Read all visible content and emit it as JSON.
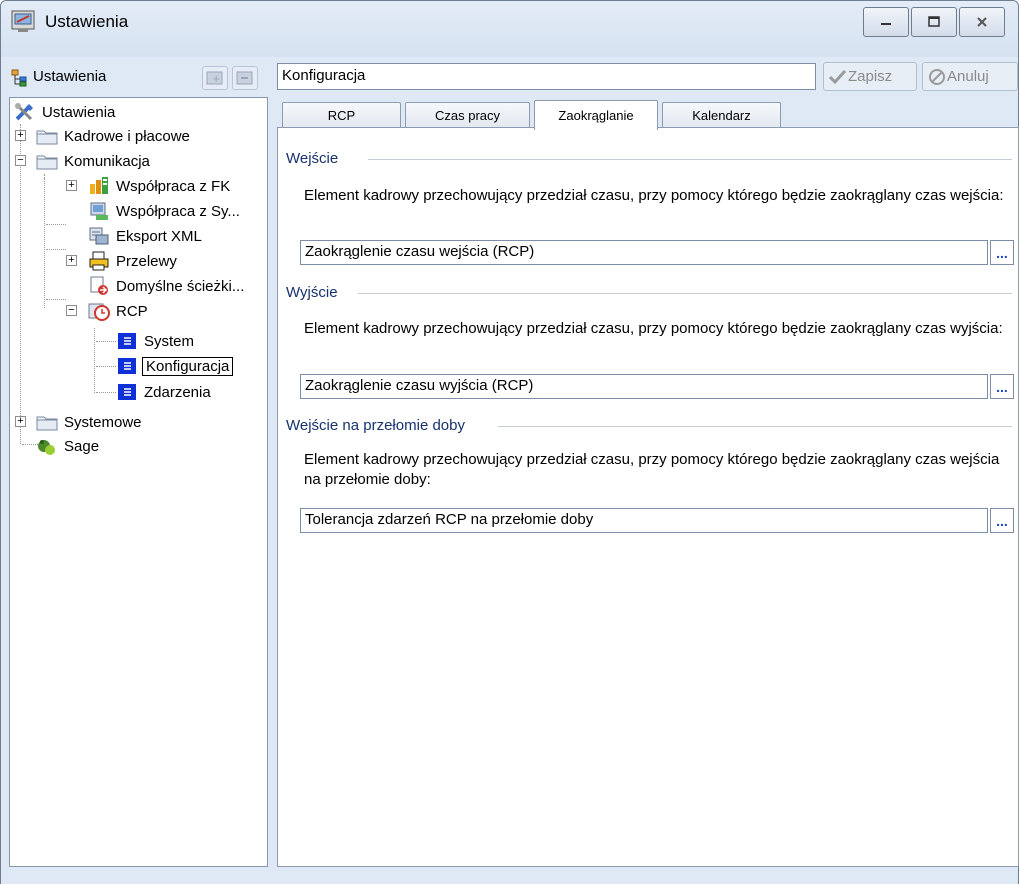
{
  "window": {
    "title": "Ustawienia",
    "icon": "settings-window-icon"
  },
  "left_panel": {
    "title": "Ustawienia",
    "tree": {
      "root": "Ustawienia",
      "kadrowe": "Kadrowe i płacowe",
      "komunikacja": "Komunikacja",
      "wspolpraca_fk": "Współpraca z FK",
      "wspolpraca_sy": "Współpraca z Sy...",
      "eksport_xml": "Eksport XML",
      "przelewy": "Przelewy",
      "domyslne": "Domyślne ścieżki...",
      "rcp": "RCP",
      "system": "System",
      "konfiguracja": "Konfiguracja",
      "zdarzenia": "Zdarzenia",
      "systemowe": "Systemowe",
      "sage": "Sage"
    }
  },
  "header": {
    "config_value": "Konfiguracja",
    "save_label": "Zapisz",
    "cancel_label": "Anuluj"
  },
  "tabs": [
    {
      "label": "RCP"
    },
    {
      "label": "Czas pracy"
    },
    {
      "label": "Zaokrąglanie"
    },
    {
      "label": "Kalendarz"
    }
  ],
  "active_tab": "Zaokrąglanie",
  "sections": {
    "wejscie": {
      "title": "Wejście",
      "description": "Element kadrowy przechowujący przedział czasu, przy pomocy którego będzie zaokrąglany czas wejścia:",
      "value": "Zaokrąglenie czasu wejścia (RCP)"
    },
    "wyjscie": {
      "title": "Wyjście",
      "description": "Element kadrowy przechowujący przedział czasu, przy pomocy którego będzie zaokrąglany czas wyjścia:",
      "value": "Zaokrąglenie czasu wyjścia (RCP)"
    },
    "przelom": {
      "title": "Wejście na przełomie doby",
      "description": "Element kadrowy przechowujący przedział czasu, przy pomocy którego będzie zaokrąglany czas wejścia na przełomie doby:",
      "value": "Tolerancja zdarzeń RCP na przełomie doby"
    }
  },
  "browse_label": "...",
  "colors": {
    "group_title": "#16326e",
    "window_bg": "#dfe9f5",
    "link_blue": "#1b46c4"
  }
}
